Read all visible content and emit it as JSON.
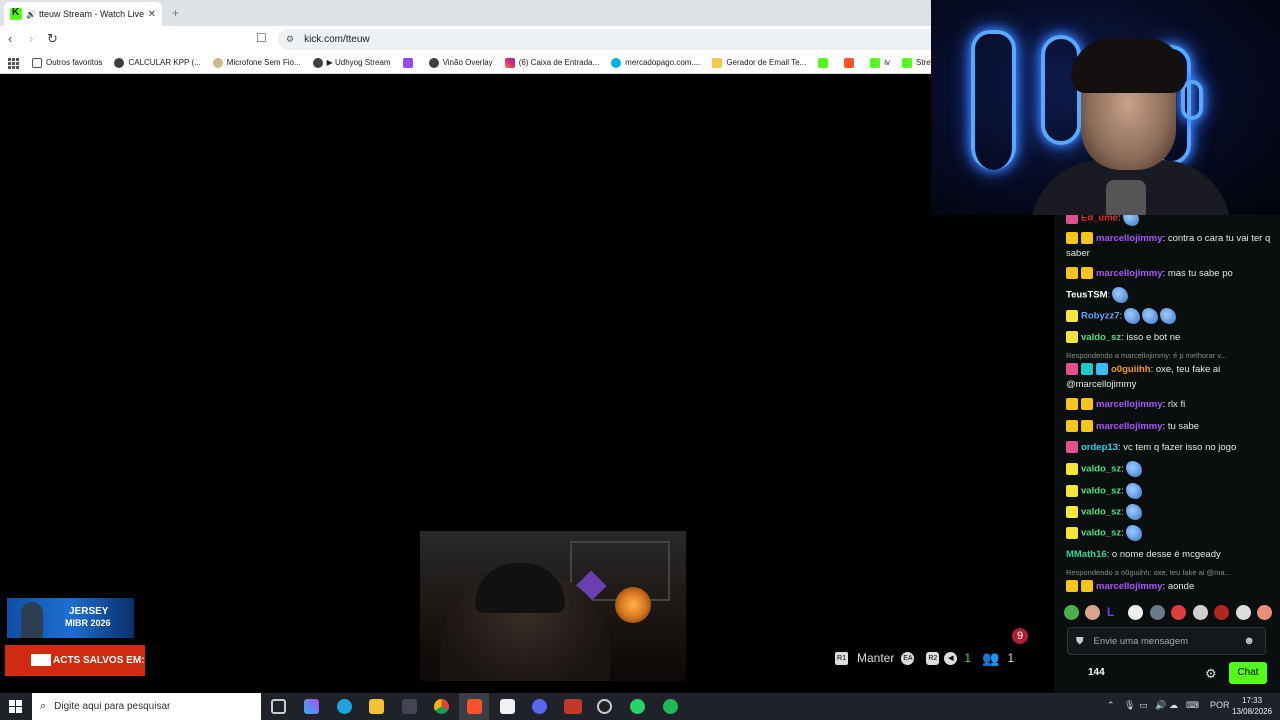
{
  "browser": {
    "tab_title": "tteuw Stream - Watch Live o",
    "url": "kick.com/tteuw",
    "new_tab": "+"
  },
  "bookmarks": [
    {
      "label": "Outros favoritos"
    },
    {
      "label": "CALCULAR KPP (..."
    },
    {
      "label": "Microfone Sem Fio..."
    },
    {
      "label": "▶ Udhyog Stream"
    },
    {
      "label": ""
    },
    {
      "label": "Vinão Overlay"
    },
    {
      "label": "(6) Caixa de Entrada..."
    },
    {
      "label": "mercadopago.com...."
    },
    {
      "label": "Gerador de Email Te..."
    },
    {
      "label": ""
    },
    {
      "label": ""
    },
    {
      "label": "iv"
    },
    {
      "label": "Strea"
    }
  ],
  "stream": {
    "ad1_line1": "JERSEY",
    "ad1_line2": "MIBR 2026",
    "ad2_text": "ACTS SALVOS EM:",
    "overlay_manter": "Manter",
    "overlay_count_green": "1",
    "overlay_count_users": "1",
    "notification_count": "9"
  },
  "chat": {
    "messages": [
      {
        "user": "Ed_ume",
        "text": ":",
        "color": "#e03131",
        "badges": [
          "pink"
        ],
        "emotes": 1
      },
      {
        "user": "marcellojimmy",
        "text": ": contra o cara tu vai ter q saber",
        "color": "#a855f7",
        "badges": [
          "crown",
          "sub"
        ],
        "emotes": 0
      },
      {
        "user": "marcellojimmy",
        "text": ": mas tu sabe po",
        "color": "#a855f7",
        "badges": [
          "crown",
          "sub"
        ],
        "emotes": 0
      },
      {
        "user": "TeusTSM",
        "text": ":",
        "color": "#ffffff",
        "badges": [],
        "emotes": 1
      },
      {
        "user": "Robyzz7",
        "text": ":",
        "color": "#60a5fa",
        "badges": [
          "num19"
        ],
        "emotes": 3
      },
      {
        "user": "valdo_sz",
        "text": ": isso e bot ne",
        "color": "#4ade80",
        "badges": [
          "num12"
        ],
        "emotes": 0
      },
      {
        "reply": "Respondendo a marcellojimmy: é p melhorar v..."
      },
      {
        "user": "o0guiihh",
        "text": ": oxe, teu fake ai @marcellojimmy",
        "color": "#f59e0b",
        "badges": [
          "pink",
          "teal",
          "blue"
        ],
        "emotes": 0
      },
      {
        "user": "marcellojimmy",
        "text": ": rlx fi",
        "color": "#a855f7",
        "badges": [
          "crown",
          "sub"
        ],
        "emotes": 0
      },
      {
        "user": "marcellojimmy",
        "text": ": tu sabe",
        "color": "#a855f7",
        "badges": [
          "crown",
          "sub"
        ],
        "emotes": 0
      },
      {
        "user": "ordep13",
        "text": ": vc tem q fazer isso no jogo",
        "color": "#22d3ee",
        "badges": [
          "pink"
        ],
        "emotes": 0
      },
      {
        "user": "valdo_sz",
        "text": ":",
        "color": "#4ade80",
        "badges": [
          "num12"
        ],
        "emotes": 1
      },
      {
        "user": "valdo_sz",
        "text": ":",
        "color": "#4ade80",
        "badges": [
          "num12"
        ],
        "emotes": 1
      },
      {
        "user": "valdo_sz",
        "text": ":",
        "color": "#4ade80",
        "badges": [
          "num12"
        ],
        "emotes": 1
      },
      {
        "user": "valdo_sz",
        "text": ":",
        "color": "#4ade80",
        "badges": [
          "num12"
        ],
        "emotes": 1
      },
      {
        "user": "MMath16",
        "text": ": o nome desse é mcgeady",
        "color": "#34d399",
        "badges": [],
        "emotes": 0
      },
      {
        "reply": "Respondendo a o0guiihh: oxe, teu fake ai @ma..."
      },
      {
        "user": "marcellojimmy",
        "text": ": aonde",
        "color": "#a855f7",
        "badges": [
          "crown",
          "sub"
        ],
        "emotes": 0
      }
    ],
    "input_placeholder": "Envie uma mensagem",
    "viewer_count": "144",
    "chat_button": "Chat"
  },
  "taskbar": {
    "search_placeholder": "Digite aqui para pesquisar",
    "language": "POR",
    "time": "17:33",
    "date": "13/08/2026"
  }
}
